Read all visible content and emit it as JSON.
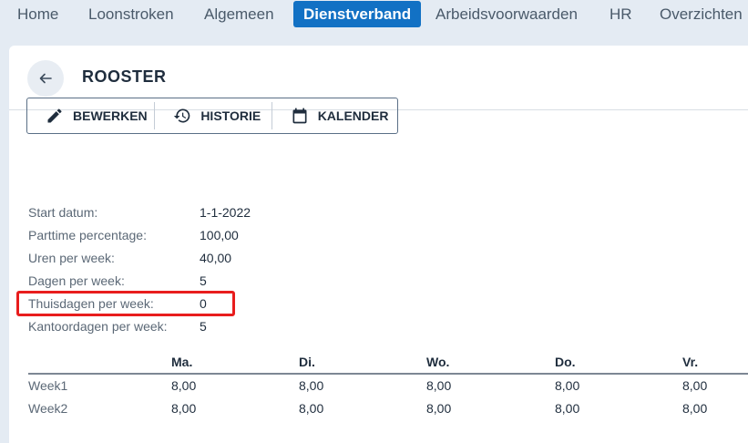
{
  "nav": {
    "items": [
      "Home",
      "Loonstroken",
      "Algemeen",
      "Dienstverband",
      "Arbeidsvoorwaarden",
      "HR",
      "Overzichten"
    ],
    "active_index": 3
  },
  "page": {
    "title": "ROOSTER",
    "back_icon": "arrow-left-icon"
  },
  "toolbar": {
    "edit_label": "BEWERKEN",
    "history_label": "HISTORIE",
    "calendar_label": "KALENDER"
  },
  "details": [
    {
      "label": "Start datum:",
      "value": "1-1-2022"
    },
    {
      "label": "Parttime percentage:",
      "value": "100,00"
    },
    {
      "label": "Uren per week:",
      "value": "40,00"
    },
    {
      "label": "Dagen per week:",
      "value": "5"
    },
    {
      "label": "Thuisdagen per week:",
      "value": "0"
    },
    {
      "label": "Kantoordagen per week:",
      "value": "5"
    }
  ],
  "schedule": {
    "columns": [
      "",
      "Ma.",
      "Di.",
      "Wo.",
      "Do.",
      "Vr."
    ],
    "rows": [
      {
        "label": "Week1",
        "values": [
          "8,00",
          "8,00",
          "8,00",
          "8,00",
          "8,00"
        ]
      },
      {
        "label": "Week2",
        "values": [
          "8,00",
          "8,00",
          "8,00",
          "8,00",
          "8,00"
        ]
      }
    ]
  },
  "colors": {
    "accent": "#1271c4",
    "highlight": "#e81d1d",
    "background": "#e4ebf3"
  }
}
